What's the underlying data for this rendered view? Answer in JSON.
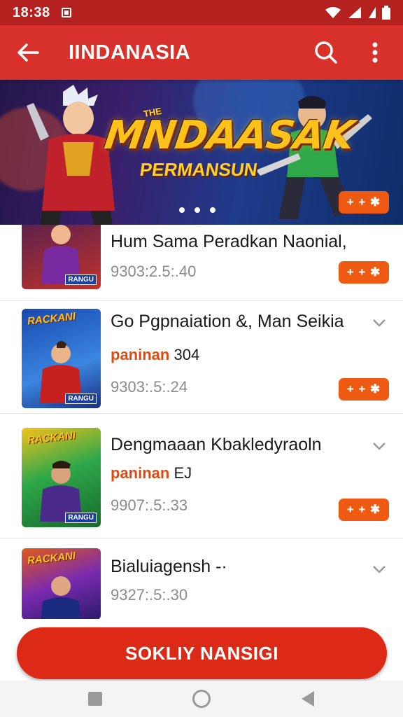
{
  "status_bar": {
    "time": "18:38"
  },
  "app_bar": {
    "title": "IINDANASIA"
  },
  "banner": {
    "kicker": "THE",
    "title": "MNDAASAK",
    "subtitle": "PERMANSUN",
    "chip": "+ + ✱",
    "dots": 3
  },
  "thumbnails": {
    "brand": "RACKANI",
    "tag": "RANGU"
  },
  "list": [
    {
      "title": "Hum Sama Peradkan Naonial,",
      "subtitle_accent": "",
      "subtitle_rest": "",
      "meta": "9303:2.5:.40",
      "chip": "+ + ✱"
    },
    {
      "title": "Go Pgpnaiation &, Man Seikia",
      "subtitle_accent": "paninan",
      "subtitle_rest": "304",
      "meta": "9303:.5:.24",
      "chip": "+ + ✱"
    },
    {
      "title": "Dengmaaan Kbakledyraoln",
      "subtitle_accent": "paninan",
      "subtitle_rest": "EJ",
      "meta": "9907:.5:.33",
      "chip": "+ + ✱"
    },
    {
      "title": "Bialuiagensh -·",
      "subtitle_accent": "",
      "subtitle_rest": "",
      "meta": "9327:.5:.30",
      "chip": ""
    }
  ],
  "cta": {
    "label": "SOKLIY NANSIGI"
  },
  "colors": {
    "primary": "#d8302a",
    "status": "#b5211f",
    "accent": "#ee5a12",
    "cta": "#dd2a16"
  },
  "icons": [
    "back-arrow-icon",
    "search-icon",
    "more-vert-icon",
    "chevron-down-icon",
    "wifi-icon",
    "signal-icon",
    "battery-icon"
  ]
}
